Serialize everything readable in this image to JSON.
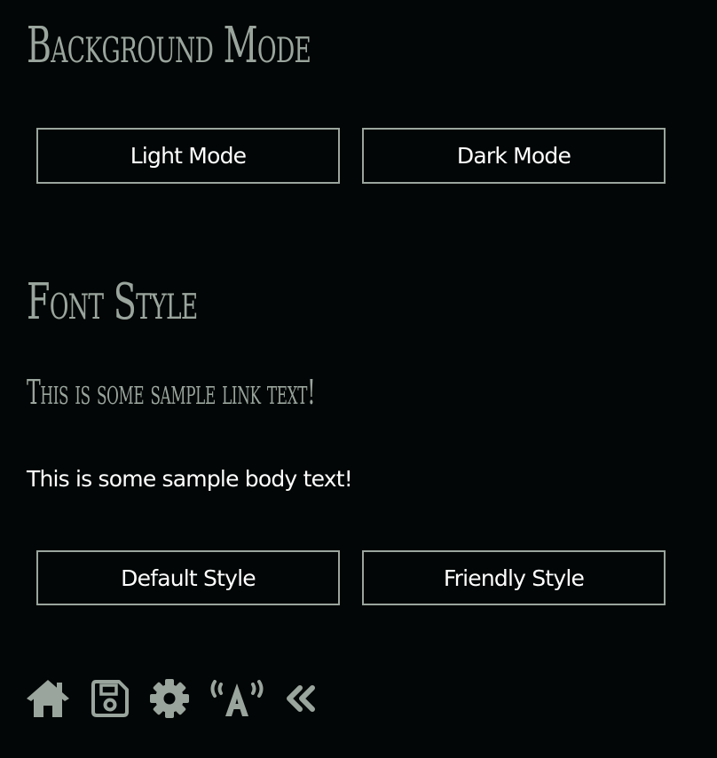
{
  "sections": {
    "background": {
      "title": "Background Mode",
      "buttons": {
        "light": "Light Mode",
        "dark": "Dark Mode"
      }
    },
    "font": {
      "title": "Font Style",
      "link_sample": "This is some sample link text!",
      "body_sample": "This is some sample body text!",
      "buttons": {
        "default": "Default Style",
        "friendly": "Friendly Style"
      }
    }
  },
  "toolbar": {
    "icons": [
      "home-icon",
      "save-icon",
      "gear-icon",
      "font-broadcast-icon",
      "double-chevron-left-icon"
    ]
  },
  "colors": {
    "background": "#020606",
    "accent": "#9aa59d",
    "text": "#ffffff"
  }
}
